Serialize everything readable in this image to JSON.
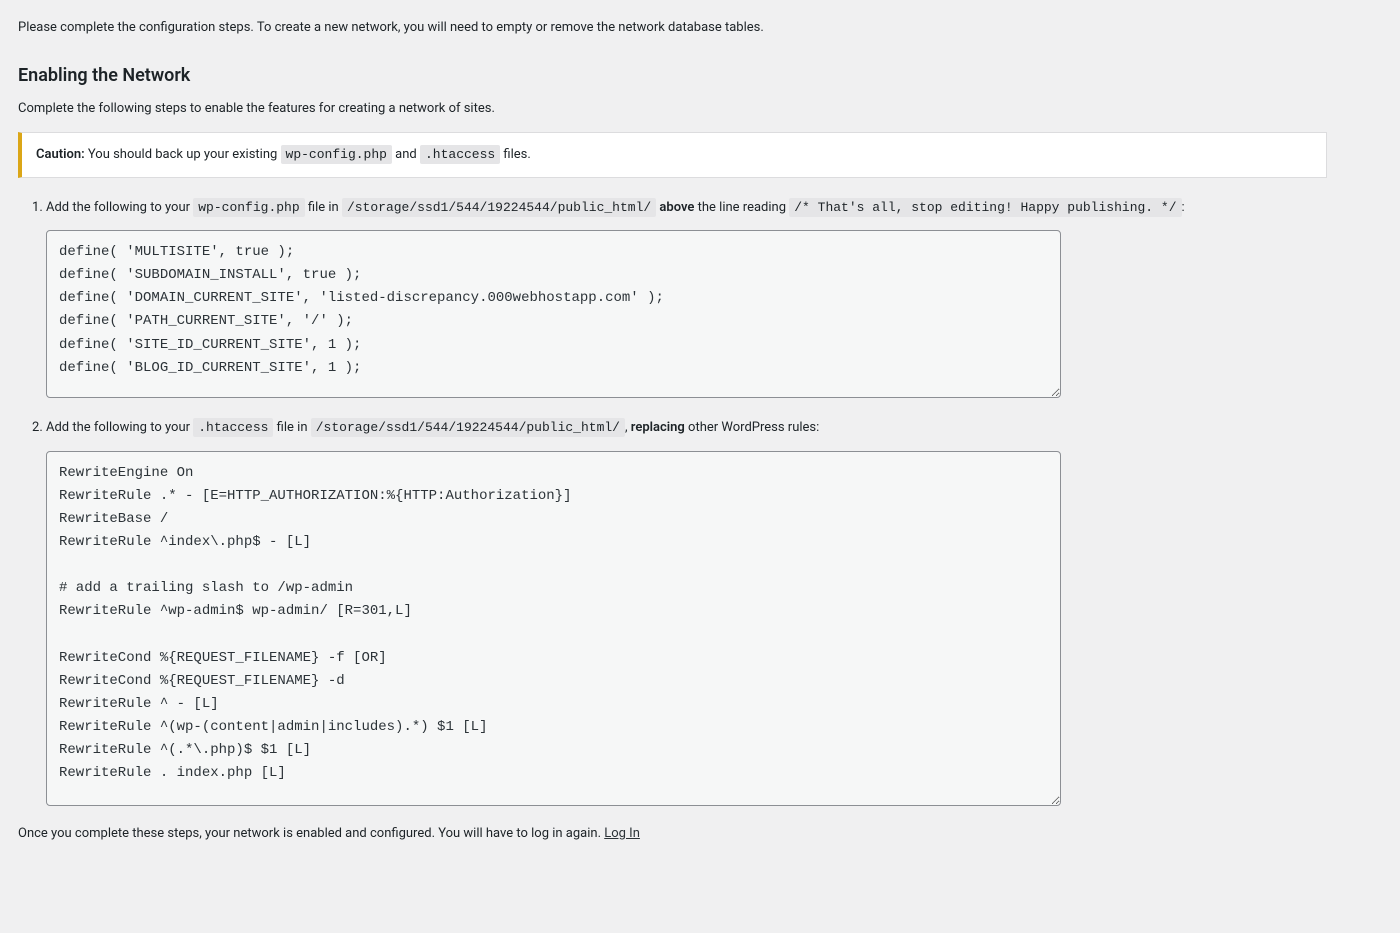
{
  "intro": "Please complete the configuration steps. To create a new network, you will need to empty or remove the network database tables.",
  "heading": "Enabling the Network",
  "heading_desc": "Complete the following steps to enable the features for creating a network of sites.",
  "caution": {
    "label": "Caution:",
    "pre": " You should back up your existing ",
    "file1": "wp-config.php",
    "and": " and ",
    "file2": ".htaccess",
    "post": " files."
  },
  "step1": {
    "pre": "Add the following to your ",
    "file": "wp-config.php",
    "mid1": " file in ",
    "path": "/storage/ssd1/544/19224544/public_html/",
    "above": "above",
    "mid2": " the line reading ",
    "comment": "/* That's all, stop editing! Happy publishing. */",
    "post": ":"
  },
  "code1": "define( 'MULTISITE', true );\ndefine( 'SUBDOMAIN_INSTALL', true );\ndefine( 'DOMAIN_CURRENT_SITE', 'listed-discrepancy.000webhostapp.com' );\ndefine( 'PATH_CURRENT_SITE', '/' );\ndefine( 'SITE_ID_CURRENT_SITE', 1 );\ndefine( 'BLOG_ID_CURRENT_SITE', 1 );",
  "step2": {
    "pre": "Add the following to your ",
    "file": ".htaccess",
    "mid1": " file in ",
    "path": "/storage/ssd1/544/19224544/public_html/",
    "sep": ", ",
    "replacing": "replacing",
    "post": " other WordPress rules:"
  },
  "code2": "RewriteEngine On\nRewriteRule .* - [E=HTTP_AUTHORIZATION:%{HTTP:Authorization}]\nRewriteBase /\nRewriteRule ^index\\.php$ - [L]\n\n# add a trailing slash to /wp-admin\nRewriteRule ^wp-admin$ wp-admin/ [R=301,L]\n\nRewriteCond %{REQUEST_FILENAME} -f [OR]\nRewriteCond %{REQUEST_FILENAME} -d\nRewriteRule ^ - [L]\nRewriteRule ^(wp-(content|admin|includes).*) $1 [L]\nRewriteRule ^(.*\\.php)$ $1 [L]\nRewriteRule . index.php [L]",
  "final": {
    "text": "Once you complete these steps, your network is enabled and configured. You will have to log in again. ",
    "link": "Log In"
  }
}
